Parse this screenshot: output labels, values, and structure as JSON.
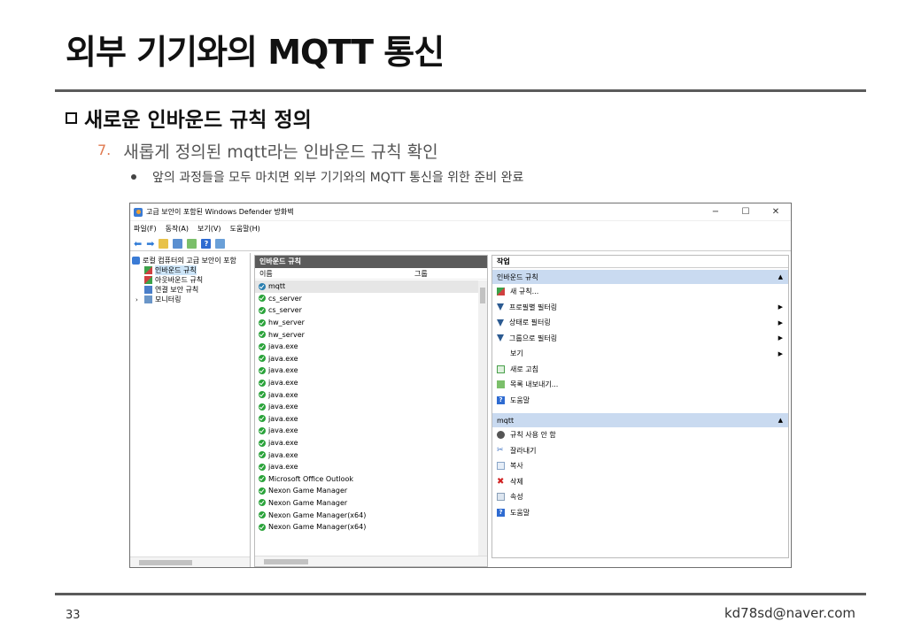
{
  "slide": {
    "title": "외부 기기와의 MQTT 통신",
    "section": "새로운 인바운드 규칙 정의",
    "step_number": "7.",
    "step_text": "새롭게 정의된 mqtt라는 인바운드 규칙 확인",
    "sub_text": "앞의 과정들을 모두 마치면 외부 기기와의 MQTT 통신을 위한 준비 완료",
    "page_number": "33",
    "email": "kd78sd@naver.com"
  },
  "window": {
    "title": "고급 보안이 포함된 Windows Defender 방화벽",
    "controls": {
      "minimize": "−",
      "maximize": "☐",
      "close": "✕"
    },
    "menu": [
      "파일(F)",
      "동작(A)",
      "보기(V)",
      "도움말(H)"
    ],
    "tree": {
      "root": "로컬 컴퓨터의 고급 보안이 포함",
      "items": [
        "인바운드 규칙",
        "아웃바운드 규칙",
        "연결 보안 규칙",
        "모니터링"
      ]
    },
    "rules_pane": {
      "header": "인바운드 규칙",
      "col_name": "이름",
      "col_group": "그룹",
      "rows": [
        "mqtt",
        "cs_server",
        "cs_server",
        "hw_server",
        "hw_server",
        "java.exe",
        "java.exe",
        "java.exe",
        "java.exe",
        "java.exe",
        "java.exe",
        "java.exe",
        "java.exe",
        "java.exe",
        "java.exe",
        "java.exe",
        "Microsoft Office Outlook",
        "Nexon Game Manager",
        "Nexon Game Manager",
        "Nexon Game Manager(x64)",
        "Nexon Game Manager(x64)"
      ]
    },
    "actions": {
      "header": "작업",
      "group1": {
        "title": "인바운드 규칙",
        "items": [
          {
            "label": "새 규칙...",
            "icon": "new-rule-icon",
            "sub": false
          },
          {
            "label": "프로필별 필터링",
            "icon": "filter-icon",
            "sub": true
          },
          {
            "label": "상태로 필터링",
            "icon": "filter-icon",
            "sub": true
          },
          {
            "label": "그룹으로 필터링",
            "icon": "filter-icon",
            "sub": true
          },
          {
            "label": "보기",
            "icon": "",
            "sub": true
          },
          {
            "label": "새로 고침",
            "icon": "refresh-icon",
            "sub": false
          },
          {
            "label": "목록 내보내기...",
            "icon": "export-icon",
            "sub": false
          },
          {
            "label": "도움말",
            "icon": "help-icon",
            "sub": false
          }
        ]
      },
      "group2": {
        "title": "mqtt",
        "items": [
          {
            "label": "규칙 사용 안 함",
            "icon": "disable-icon"
          },
          {
            "label": "잘라내기",
            "icon": "cut-icon"
          },
          {
            "label": "복사",
            "icon": "copy-icon"
          },
          {
            "label": "삭제",
            "icon": "delete-icon"
          },
          {
            "label": "속성",
            "icon": "properties-icon"
          },
          {
            "label": "도움말",
            "icon": "help-icon"
          }
        ]
      }
    }
  },
  "colors": {
    "accent": "#e07a50",
    "rule": "#5b5b5b",
    "pane_header": "#5b5b5b",
    "action_group": "#c9daf0",
    "allow": "#2aa33a"
  }
}
